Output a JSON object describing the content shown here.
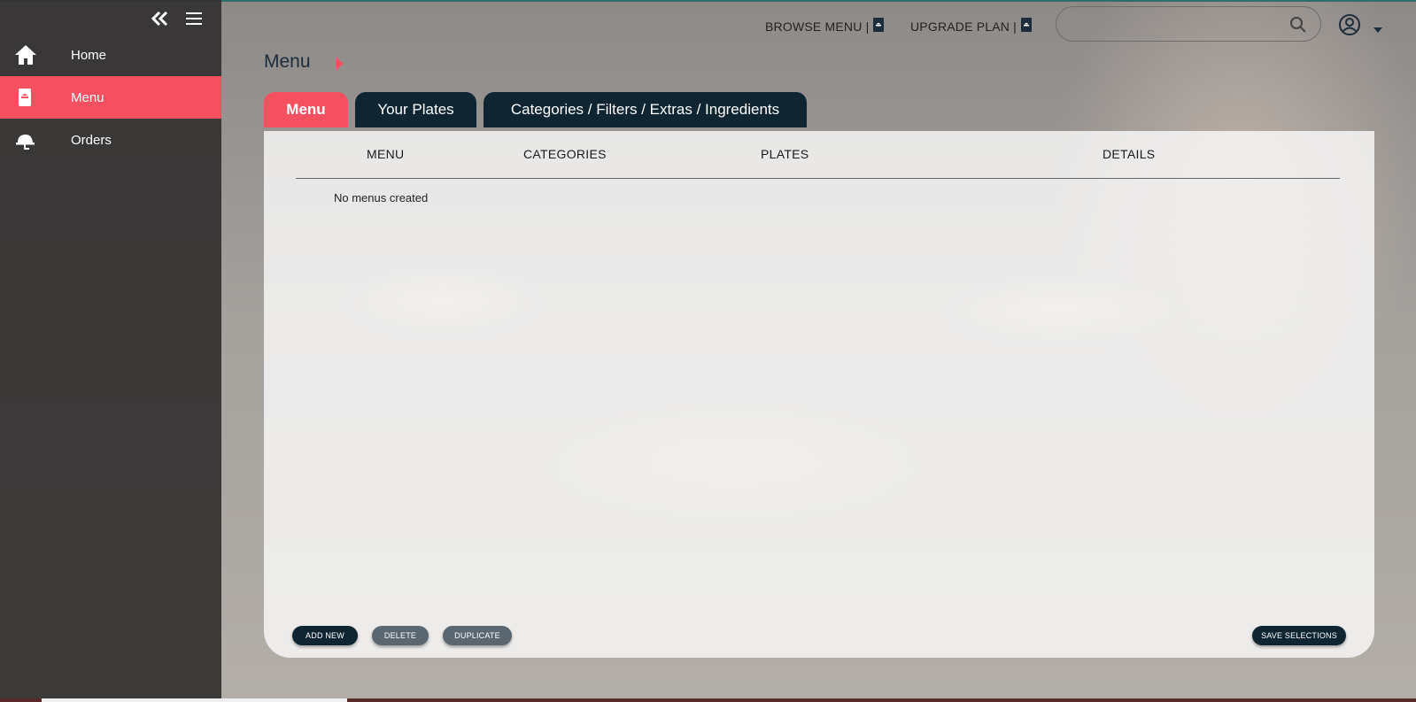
{
  "sidebar": {
    "collapse_icon": "double-chevron-left-icon",
    "menu_icon": "hamburger-icon",
    "items": [
      {
        "label": "Home",
        "icon": "home-icon"
      },
      {
        "label": "Menu",
        "icon": "menu-book-icon",
        "active": true
      },
      {
        "label": "Orders",
        "icon": "cloche-icon"
      }
    ]
  },
  "header": {
    "browse_menu": "BROWSE MENU |",
    "upgrade_plan": "UPGRADE PLAN |",
    "search": {
      "placeholder": "",
      "value": ""
    },
    "icons": [
      "search-icon",
      "user-circle-icon",
      "caret-down-icon"
    ]
  },
  "page": {
    "title": "Menu",
    "tabs": [
      {
        "label": "Menu",
        "active": true
      },
      {
        "label": "Your Plates"
      },
      {
        "label": "Categories / Filters / Extras / Ingredients"
      }
    ]
  },
  "table": {
    "columns": [
      "MENU",
      "CATEGORIES",
      "PLATES",
      "DETAILS"
    ],
    "empty_message": "No menus created"
  },
  "actions": {
    "add_new": "ADD NEW",
    "delete": "DELETE",
    "duplicate": "DUPLICATE",
    "save_selections": "SAVE SELECTIONS"
  },
  "colors": {
    "accent": "#f4505f",
    "dark_navy": "#0f2532",
    "sidebar_bg": "#323030",
    "grey_button": "#5b6770"
  }
}
